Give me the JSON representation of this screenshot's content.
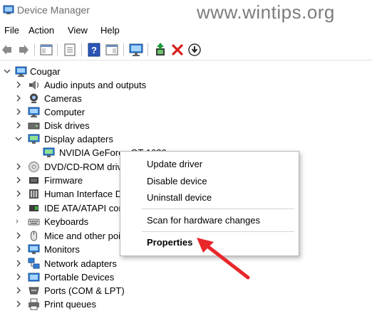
{
  "window": {
    "title": "Device Manager",
    "watermark": "www.wintips.org"
  },
  "menu": [
    "File",
    "Action",
    "View",
    "Help"
  ],
  "toolbar": {
    "icons": [
      "back-arrow-icon",
      "forward-arrow-icon",
      "properties-pane-icon",
      "console-tree-icon",
      "help-icon",
      "action-pane-icon",
      "monitor-icon",
      "update-driver-icon",
      "uninstall-x-icon",
      "enable-device-icon"
    ],
    "colors": {
      "uninstall": "#d81e1e",
      "update": "#1b9a3a"
    }
  },
  "tree": {
    "root": "Cougar",
    "items": [
      {
        "label": "Audio inputs and outputs",
        "icon": "speaker-icon"
      },
      {
        "label": "Cameras",
        "icon": "camera-icon"
      },
      {
        "label": "Computer",
        "icon": "computer-icon"
      },
      {
        "label": "Disk drives",
        "icon": "disk-drive-icon"
      },
      {
        "label": "Display adapters",
        "icon": "display-adapter-icon",
        "expanded": true
      },
      {
        "label": "NVIDIA GeForce GT 1030 ...",
        "icon": "display-adapter-icon",
        "child": true
      },
      {
        "label": "DVD/CD-ROM drives",
        "icon": "dvd-icon"
      },
      {
        "label": "Firmware",
        "icon": "chip-icon"
      },
      {
        "label": "Human Interface Devices",
        "icon": "hid-icon"
      },
      {
        "label": "IDE ATA/ATAPI controllers",
        "icon": "ide-controller-icon"
      },
      {
        "label": "Keyboards",
        "icon": "keyboard-icon"
      },
      {
        "label": "Mice and other pointing devices",
        "icon": "mouse-icon"
      },
      {
        "label": "Monitors",
        "icon": "monitor-icon"
      },
      {
        "label": "Network adapters",
        "icon": "network-icon"
      },
      {
        "label": "Portable Devices",
        "icon": "portable-device-icon"
      },
      {
        "label": "Ports (COM & LPT)",
        "icon": "port-icon"
      },
      {
        "label": "Print queues",
        "icon": "printer-icon"
      }
    ]
  },
  "context_menu": {
    "items": [
      "Update driver",
      "Disable device",
      "Uninstall device",
      "Scan for hardware changes",
      "Properties"
    ],
    "accent": "#e8272b"
  }
}
